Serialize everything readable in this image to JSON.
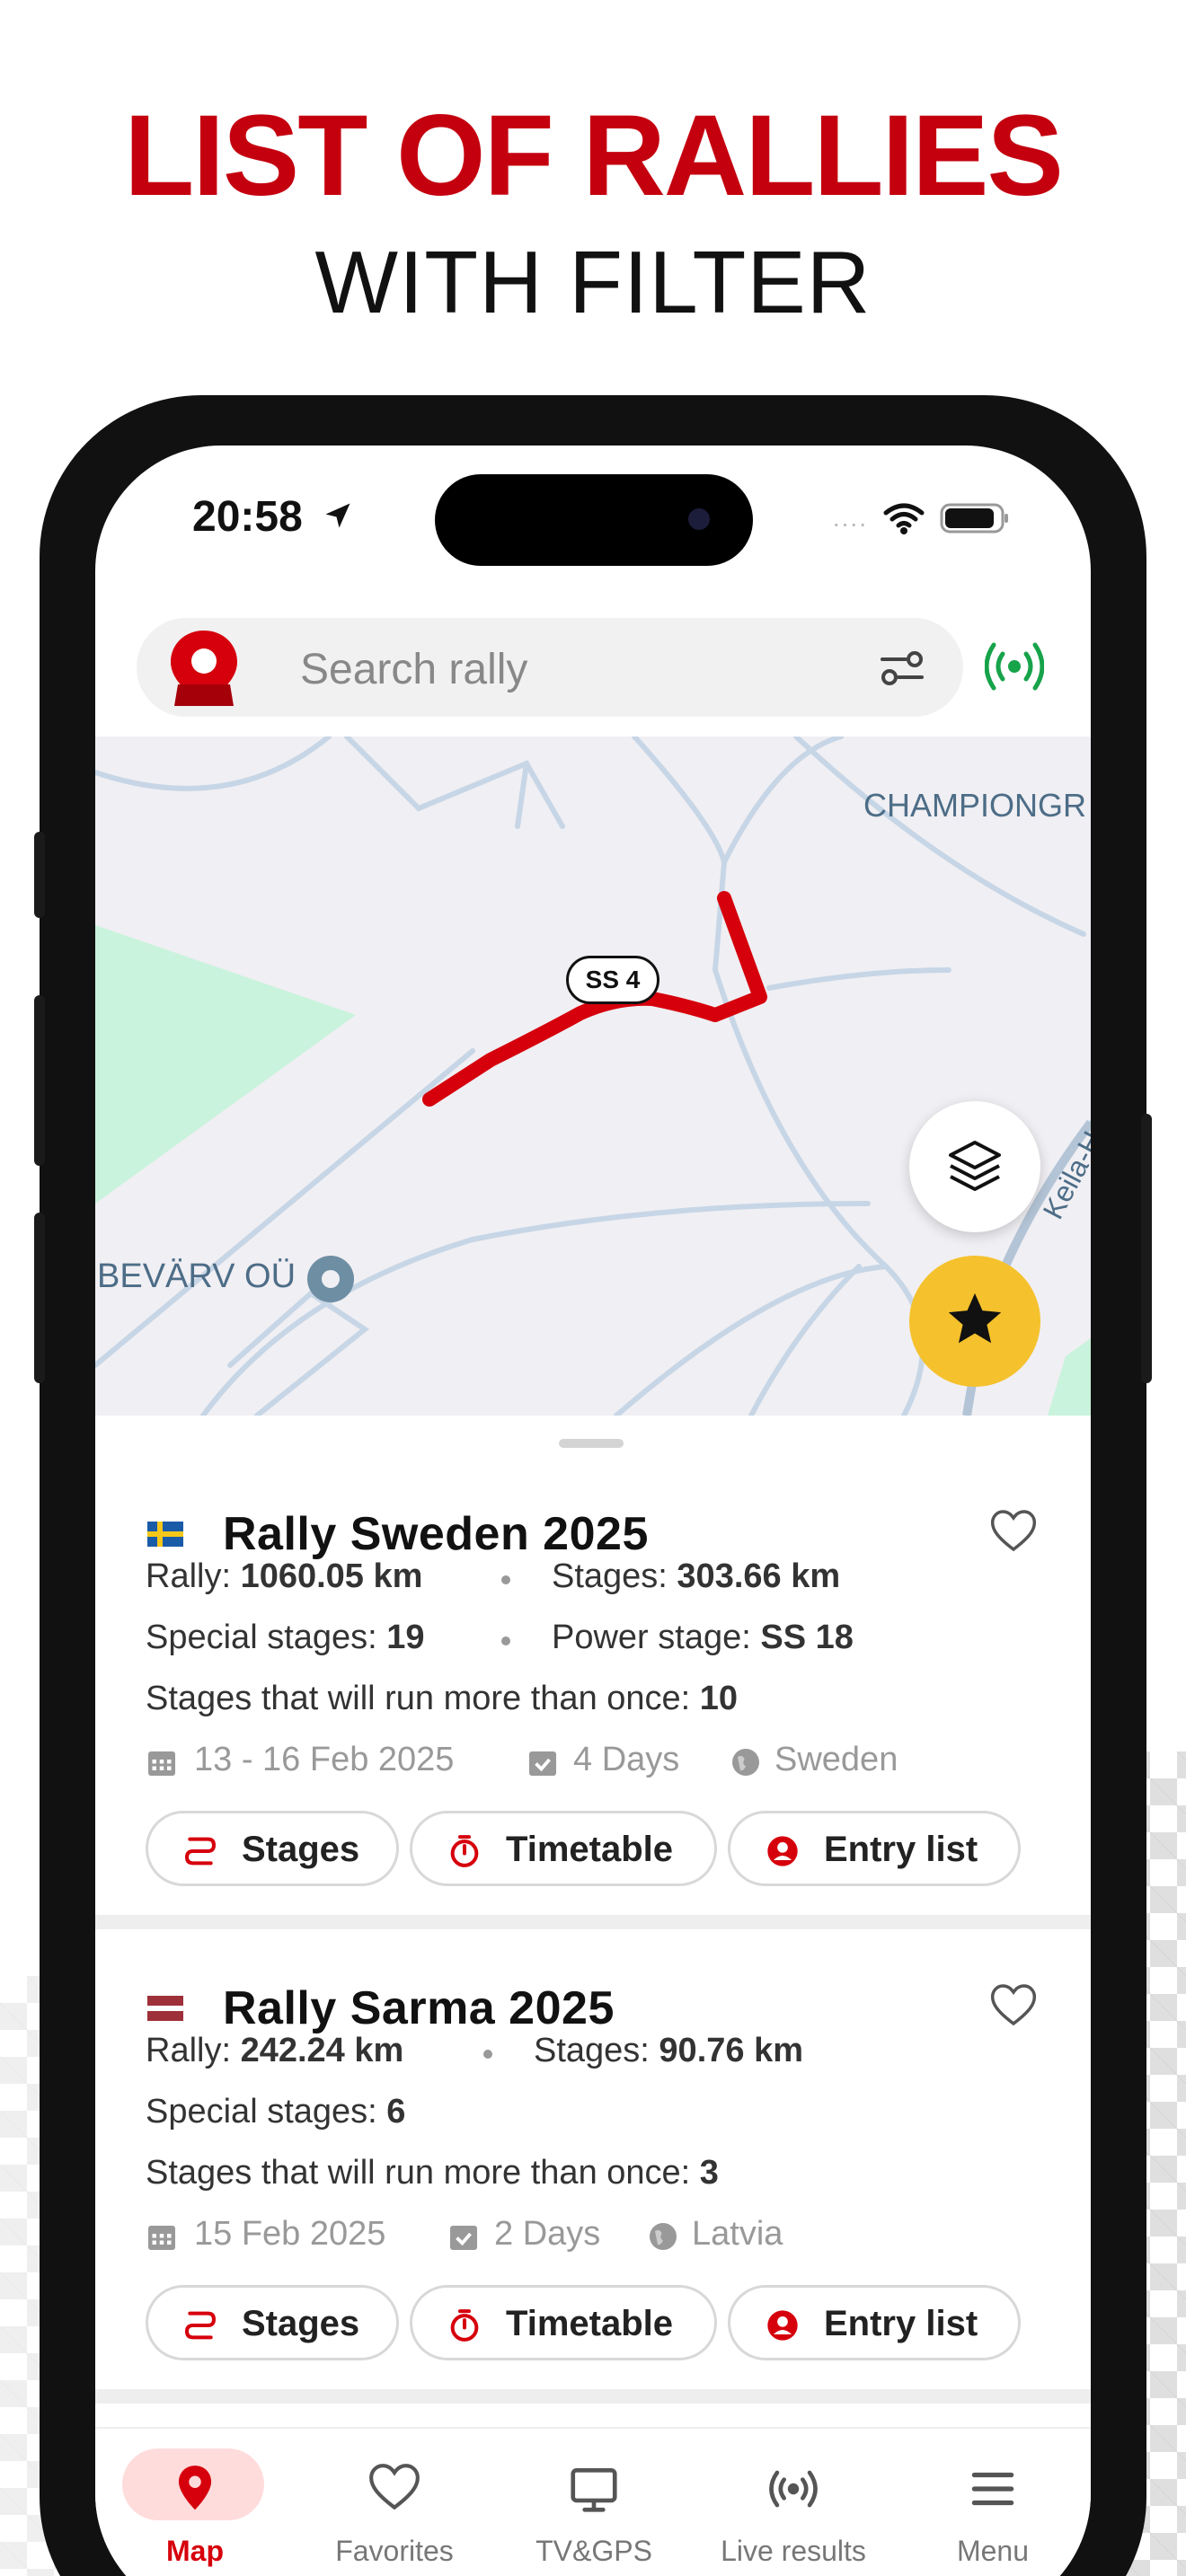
{
  "promo": {
    "headline": "LIST OF RALLIES",
    "subline": "WITH FILTER"
  },
  "status_bar": {
    "time": "20:58",
    "signal": "....",
    "icons": [
      "location-arrow-icon",
      "wifi-icon",
      "battery-icon"
    ]
  },
  "search": {
    "placeholder": "Search rally",
    "icons": [
      "app-logo",
      "filter-icon",
      "live-signal-icon"
    ]
  },
  "map": {
    "labels": {
      "championship": "CHAMPIONGR",
      "bevarv": "BEVÄRV OÜ",
      "road": "Keila-H"
    },
    "stage_label": "SS 4",
    "colors": {
      "route": "#d6000c",
      "park": "#c9f3dc",
      "road": "#c7d6e6",
      "fav": "#f5c12c"
    }
  },
  "rallies": [
    {
      "flag": "sweden-flag",
      "title": "Rally Sweden 2025",
      "rally_label": "Rally: ",
      "rally_value": "1060.05 km",
      "stages_label": "Stages: ",
      "stages_value": "303.66 km",
      "special_label": "Special stages: ",
      "special_value": "19",
      "power_label": "Power stage: ",
      "power_value": "SS 18",
      "repeat_label": "Stages that will run more than once: ",
      "repeat_value": "10",
      "dates": "13 - 16 Feb 2025",
      "days": "4 Days",
      "country": "Sweden",
      "buttons": [
        "Stages",
        "Timetable",
        "Entry list"
      ]
    },
    {
      "flag": "latvia-flag",
      "title": "Rally Sarma 2025",
      "rally_label": "Rally: ",
      "rally_value": "242.24 km",
      "stages_label": "Stages: ",
      "stages_value": "90.76 km",
      "special_label": "Special stages: ",
      "special_value": "6",
      "repeat_label": "Stages that will run more than once: ",
      "repeat_value": "3",
      "dates": "15 Feb 2025",
      "days": "2 Days",
      "country": "Latvia",
      "buttons": [
        "Stages",
        "Timetable",
        "Entry list"
      ]
    }
  ],
  "nav": {
    "items": [
      {
        "label": "Map",
        "icon": "map-pin-icon",
        "active": true
      },
      {
        "label": "Favorites",
        "icon": "heart-icon",
        "active": false
      },
      {
        "label": "TV&GPS",
        "icon": "tv-icon",
        "active": false
      },
      {
        "label": "Live results",
        "icon": "live-signal-icon",
        "active": false
      },
      {
        "label": "Menu",
        "icon": "hamburger-icon",
        "active": false
      }
    ]
  },
  "colors": {
    "brand_red": "#d6000c",
    "headline_red": "#c4000f"
  }
}
